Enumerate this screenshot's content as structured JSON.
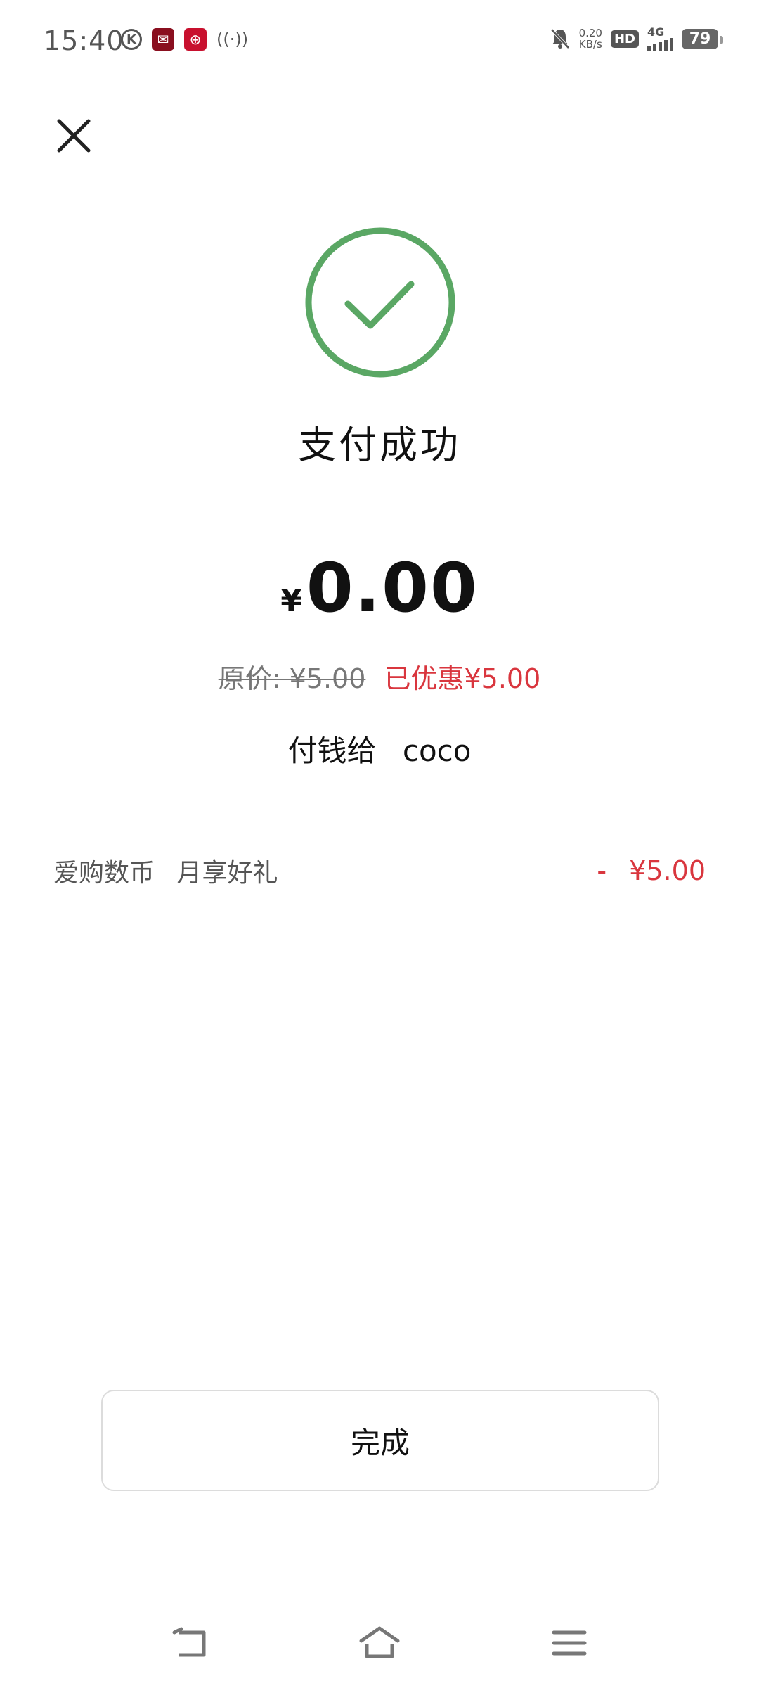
{
  "status_bar": {
    "time": "15:40",
    "net_speed_value": "0.20",
    "net_speed_unit": "KB/s",
    "hd_label": "HD",
    "network_label": "4G",
    "battery": "79",
    "left_icons": [
      "k-circle-icon",
      "bank-app-icon",
      "payment-app-icon",
      "hotspot-icon"
    ],
    "right_icons": [
      "bell-muted-icon",
      "hd-icon",
      "signal-4g-icon",
      "battery-icon"
    ]
  },
  "header": {
    "close_icon": "close-icon"
  },
  "result": {
    "status_icon": "check-circle-icon",
    "title": "支付成功",
    "accent_color": "#5aa764"
  },
  "payment": {
    "currency_symbol": "¥",
    "amount": "0.00",
    "original_label": "原价: ¥5.00",
    "discount_label": "已优惠¥5.00",
    "payee_label": "付钱给",
    "payee_name": "coco"
  },
  "promotion": {
    "name": "爱购数币",
    "desc": "月享好礼",
    "minus": "-",
    "amount": "¥5.00",
    "color": "#d9363e"
  },
  "actions": {
    "done_label": "完成"
  },
  "nav": {
    "icons": [
      "back-icon",
      "home-icon",
      "menu-icon"
    ]
  }
}
